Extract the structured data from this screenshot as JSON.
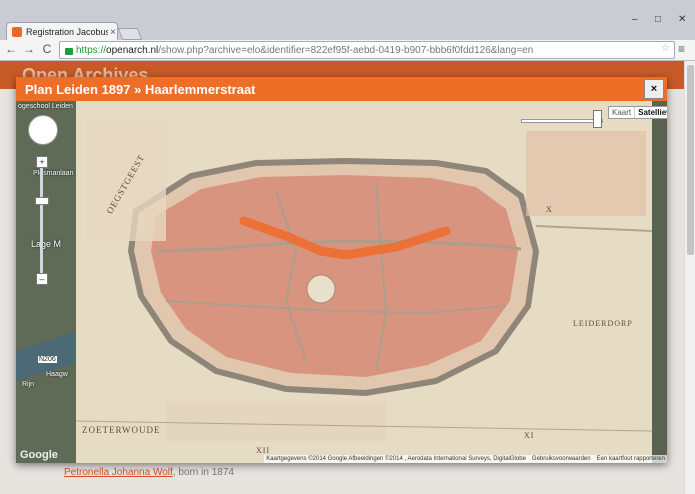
{
  "browser": {
    "tab_title": "Registration Jacobus Chri",
    "tab_close": "×",
    "url_scheme": "https://",
    "url_host": "openarch.nl",
    "url_path": "/show.php?archive=elo&identifier=822ef95f-aebd-0419-b907-bbb6f0fdd126&lang=en",
    "win_minimize": "–",
    "win_maximize": "□",
    "win_close": "✕",
    "back": "←",
    "forward": "→",
    "reload": "C",
    "star": "☆",
    "menu": "≡"
  },
  "site": {
    "logo": "Open Archives",
    "below_link_name": "Petronella Johanna Wolf",
    "below_link_suffix": ", born in 1874"
  },
  "modal": {
    "title": "Plan Leiden 1897 » Haarlemmerstraat",
    "close_label": "×"
  },
  "map": {
    "maptype_map": "Kaart",
    "maptype_satellite": "Satelliet",
    "attribution_data": "Kaartgegevens ©2014 Google Afbeeldingen ©2014 , Aerodata International Surveys, DigitalGlobe",
    "attribution_terms": "Gebruiksvoorwaarden",
    "attribution_report": "Een kaartfout rapporteren",
    "google_logo": "Google",
    "zoom_plus": "+",
    "zoom_minus": "–",
    "labels": {
      "oegstgeest": "OEGSTGEEST",
      "leiderdorp": "LEIDERDORP",
      "zoeterwoude": "ZOETERWOUDE",
      "x": "X",
      "xi": "XI",
      "xii": "XII",
      "sat_school": "ogeschool Leiden",
      "sat_plesman": "Plesmanlaan",
      "sat_lage": "Lage M",
      "sat_n206": "N206",
      "sat_rijn": "Rijn",
      "sat_haagw": "Haagw"
    }
  },
  "colors": {
    "modal_header": "#ee6e27",
    "site_header": "#c85a28",
    "highlight_street": "#f06a2a",
    "map_paper": "#e6dcc4",
    "map_buildings": "#d99480"
  }
}
